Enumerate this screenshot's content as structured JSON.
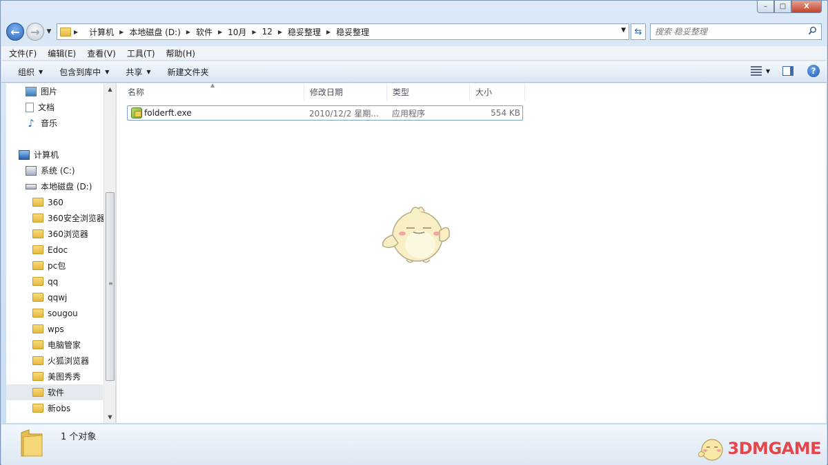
{
  "window": {
    "caption_buttons": {
      "minimize": "–",
      "maximize": "□",
      "close": "X"
    }
  },
  "address": {
    "crumbs": [
      "计算机",
      "本地磁盘 (D:)",
      "软件",
      "10月",
      "12",
      "稳妥整理",
      "稳妥整理"
    ]
  },
  "search": {
    "placeholder": "搜索 稳妥整理"
  },
  "menu": [
    "文件(F)",
    "编辑(E)",
    "查看(V)",
    "工具(T)",
    "帮助(H)"
  ],
  "commands": [
    {
      "label": "组织",
      "has_dropdown": true
    },
    {
      "label": "包含到库中",
      "has_dropdown": true
    },
    {
      "label": "共享",
      "has_dropdown": true
    },
    {
      "label": "新建文件夹",
      "has_dropdown": false
    }
  ],
  "nav": {
    "items": [
      {
        "label": "图片",
        "icon": "pictures-icon",
        "indent": 1
      },
      {
        "label": "文档",
        "icon": "documents-icon",
        "indent": 1
      },
      {
        "label": "音乐",
        "icon": "music-icon",
        "indent": 1
      },
      {
        "label": "计算机",
        "icon": "computer-icon",
        "indent": 0
      },
      {
        "label": "系统 (C:)",
        "icon": "system-drive-icon",
        "indent": 1
      },
      {
        "label": "本地磁盘 (D:)",
        "icon": "drive-icon",
        "indent": 1
      },
      {
        "label": "360",
        "icon": "folder-icon",
        "indent": 2
      },
      {
        "label": "360安全浏览器",
        "icon": "folder-icon",
        "indent": 2
      },
      {
        "label": "360浏览器",
        "icon": "folder-icon",
        "indent": 2
      },
      {
        "label": "Edoc",
        "icon": "folder-icon",
        "indent": 2
      },
      {
        "label": "pc包",
        "icon": "folder-icon",
        "indent": 2
      },
      {
        "label": "qq",
        "icon": "folder-icon",
        "indent": 2
      },
      {
        "label": "qqwj",
        "icon": "folder-icon",
        "indent": 2
      },
      {
        "label": "sougou",
        "icon": "folder-icon",
        "indent": 2
      },
      {
        "label": "wps",
        "icon": "folder-icon",
        "indent": 2
      },
      {
        "label": "电脑管家",
        "icon": "folder-icon",
        "indent": 2
      },
      {
        "label": "火狐浏览器",
        "icon": "folder-icon",
        "indent": 2
      },
      {
        "label": "美图秀秀",
        "icon": "folder-icon",
        "indent": 2
      },
      {
        "label": "软件",
        "icon": "folder-icon",
        "indent": 2,
        "selected": true
      },
      {
        "label": "新obs",
        "icon": "folder-icon",
        "indent": 2
      }
    ]
  },
  "columns": [
    "名称",
    "修改日期",
    "类型",
    "大小"
  ],
  "files": [
    {
      "name": "folderft.exe",
      "modified": "2010/12/2 星期...",
      "type": "应用程序",
      "size": "554 KB"
    }
  ],
  "status": {
    "count_text": "1 个对象"
  },
  "watermark": {
    "text": "3DMGAME"
  },
  "colors": {
    "accent": "#2b64b8",
    "selection": "#e5eaf1",
    "watermark": "#e5464a"
  }
}
